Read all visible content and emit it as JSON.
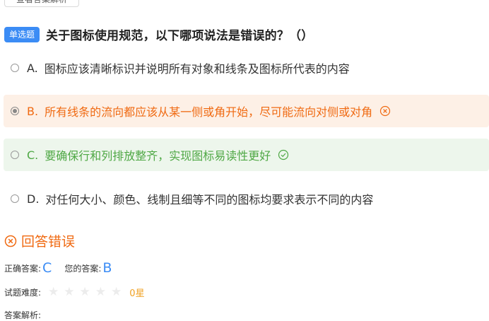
{
  "top_button": {
    "label": "查看答案解析"
  },
  "question": {
    "type_tag": "单选题",
    "title": "关于图标使用规范，以下哪项说法是错误的？（）"
  },
  "options": [
    {
      "letter": "A.",
      "text": "图标应该清晰标识并说明所有对象和线条及图标所代表的内容",
      "state": "normal"
    },
    {
      "letter": "B.",
      "text": "所有线条的流向都应该从某一侧或角开始，尽可能流向对侧或对角",
      "state": "selected-wrong",
      "icon": "close-circle-icon"
    },
    {
      "letter": "C.",
      "text": "要确保行和列排放整齐，实现图标易读性更好",
      "state": "correct",
      "icon": "check-circle-icon"
    },
    {
      "letter": "D.",
      "text": "对任何大小、颜色、线制且细等不同的图标均要求表示不同的内容",
      "state": "normal"
    }
  ],
  "result": {
    "text": "回答错误",
    "icon": "close-circle-icon"
  },
  "answer_row": {
    "correct_label": "正确答案:",
    "correct_value": "C",
    "yours_label": "您的答案:",
    "yours_value": "B"
  },
  "difficulty_row": {
    "label": "试题难度:",
    "stars_total": 5,
    "stars_filled": 0,
    "score_text": "0星"
  },
  "analysis_row": {
    "label": "答案解析:"
  },
  "colors": {
    "accent_blue": "#3b8cf5",
    "wrong_orange": "#f06a12",
    "correct_green": "#4fa845"
  }
}
